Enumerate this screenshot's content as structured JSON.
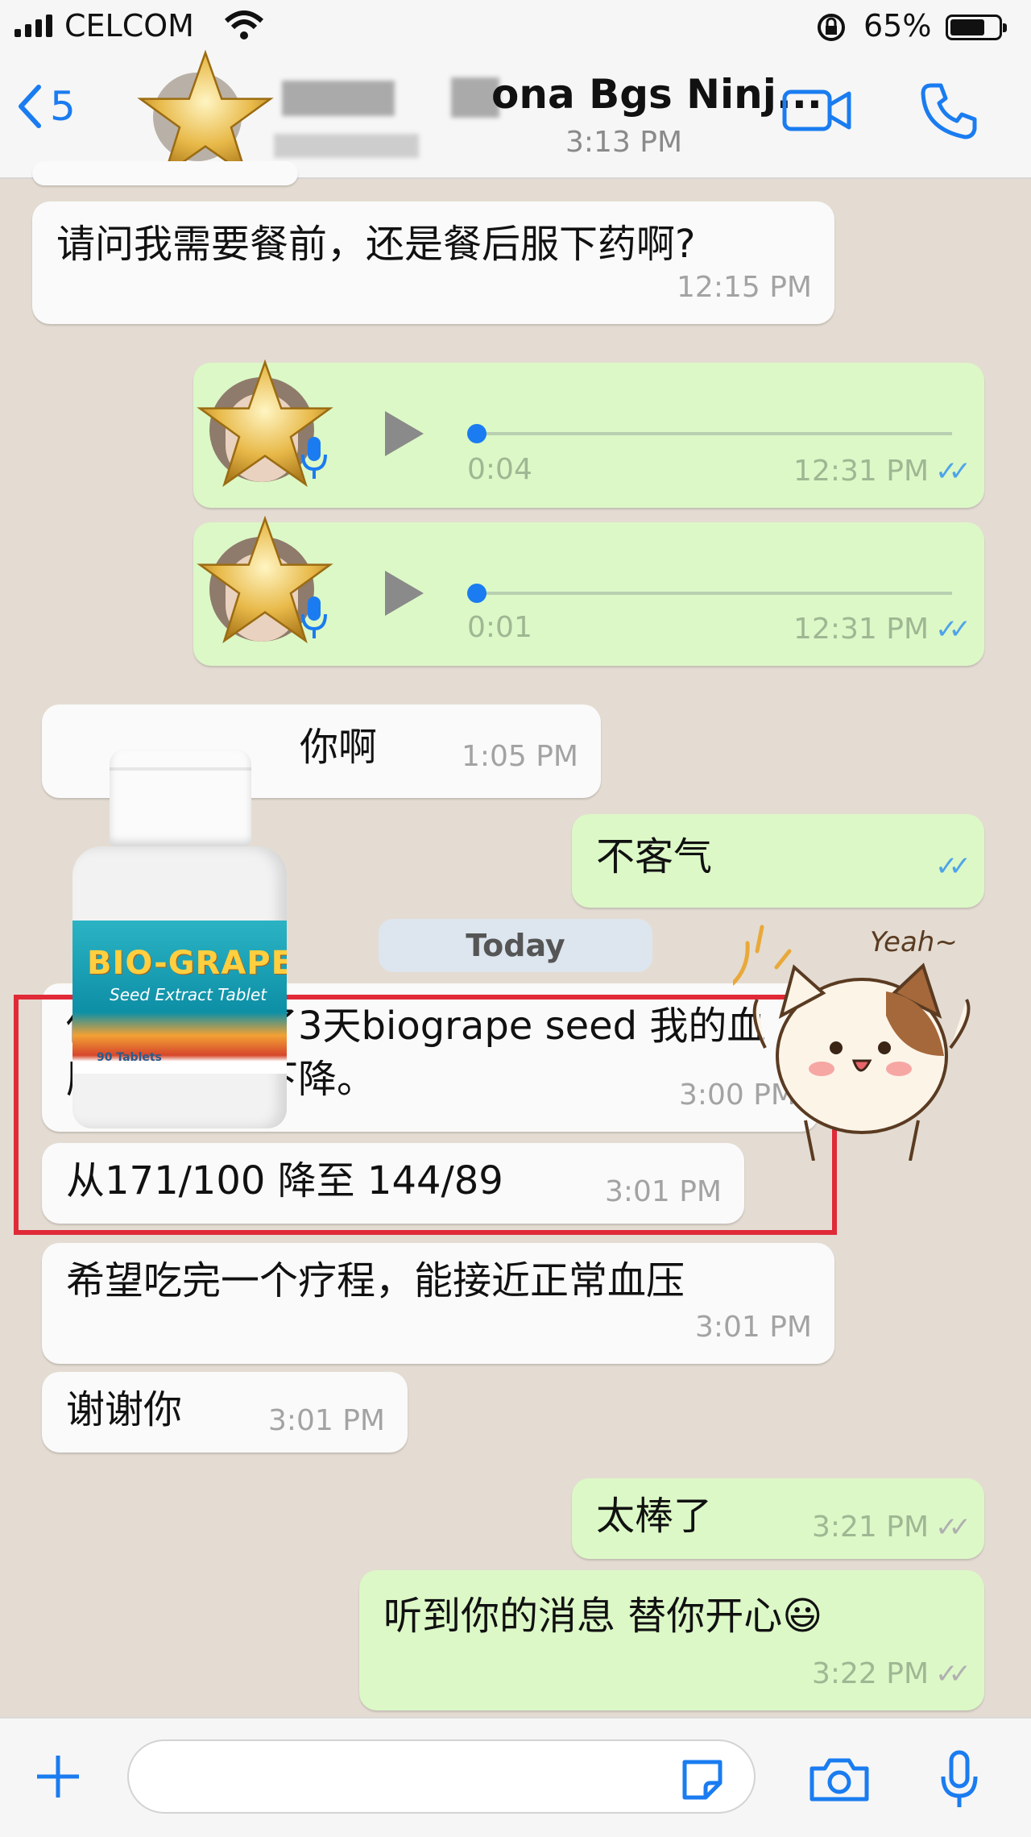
{
  "status_bar": {
    "carrier": "CELCOM",
    "battery": "65%",
    "battery_level": 0.65
  },
  "header": {
    "back_count": "5",
    "contact_name": "ona Bgs Ninj...",
    "contact_sub": "3:13 PM",
    "accent_color": "#1a7cf0"
  },
  "messages": [
    {
      "direction": "in",
      "text": "请问我需要餐前，还是餐后服下药啊?",
      "time": "12:15 PM"
    },
    {
      "direction": "out",
      "type": "voice",
      "duration": "0:04",
      "time": "12:31 PM",
      "read": true
    },
    {
      "direction": "out",
      "type": "voice",
      "duration": "0:01",
      "time": "12:31 PM",
      "read": true
    },
    {
      "direction": "in",
      "text": "你啊",
      "time": "1:05 PM"
    },
    {
      "direction": "out",
      "text": "不客气",
      "read": true
    },
    {
      "direction": "in",
      "text": "你好，我吃了3天biogrape seed 我的血压有明显的下降。",
      "time": "3:00 PM"
    },
    {
      "direction": "in",
      "text": "从171/100 降至 144/89",
      "time": "3:01 PM"
    },
    {
      "direction": "in",
      "text": "希望吃完一个疗程，能接近正常血压",
      "time": "3:01 PM"
    },
    {
      "direction": "in",
      "text": "谢谢你",
      "time": "3:01 PM"
    },
    {
      "direction": "out",
      "text": "太棒了",
      "time": "3:21 PM",
      "read": false
    },
    {
      "direction": "out",
      "text": "听到你的消息 替你开心😃",
      "time": "3:22 PM",
      "read": false
    }
  ],
  "date_divider": "Today",
  "product": {
    "brand": "BIO-GRAPE",
    "subtitle": "Seed Extract Tablet",
    "count": "90 Tablets"
  },
  "sticker_text": "Yeah~",
  "colors": {
    "incoming": "#fafafa",
    "outgoing": "#dcf8c7",
    "highlight": "#e02a38",
    "read_tick": "#4fa4e8"
  }
}
